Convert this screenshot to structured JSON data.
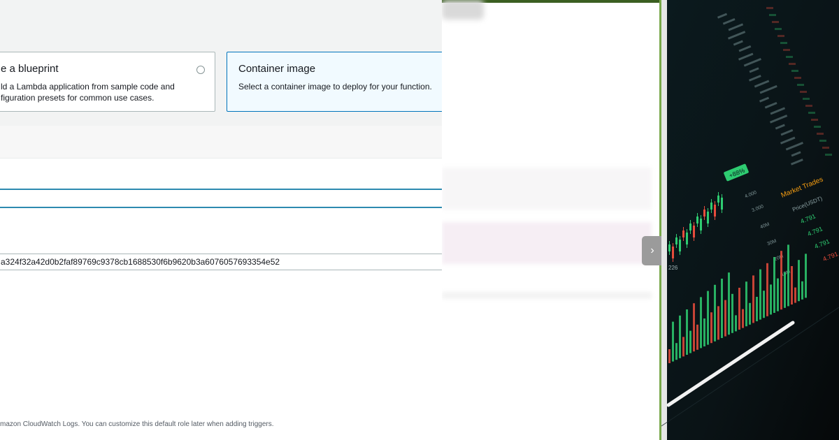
{
  "console": {
    "blueprint_card": {
      "title": "e a blueprint",
      "description": "ld a Lambda application from sample code and figuration presets for common use cases."
    },
    "container_card": {
      "title": "Container image",
      "description": "Select a container image to deploy for your function."
    },
    "image_digest": "a324f32a42d0b2faf89769c9378cb1688530f6b9620b3a6076057693354e52",
    "role_note": "mazon CloudWatch Logs. You can customize this default role later when adding triggers."
  },
  "slider": {
    "next_glyph": "›"
  },
  "photo": {
    "panel_title": "Market Trades",
    "price_header": "Price(USDT)",
    "prices": [
      "4.791",
      "4.791",
      "4.791",
      "4.791"
    ],
    "badge": "+88%",
    "amounts": [
      "4.000",
      "3.000",
      "40M",
      "30M",
      "20M",
      "10M"
    ],
    "axis_value": "226",
    "colors": {
      "green": "#2ecc71",
      "red": "#e74c3c",
      "orange": "#f39c12"
    }
  }
}
